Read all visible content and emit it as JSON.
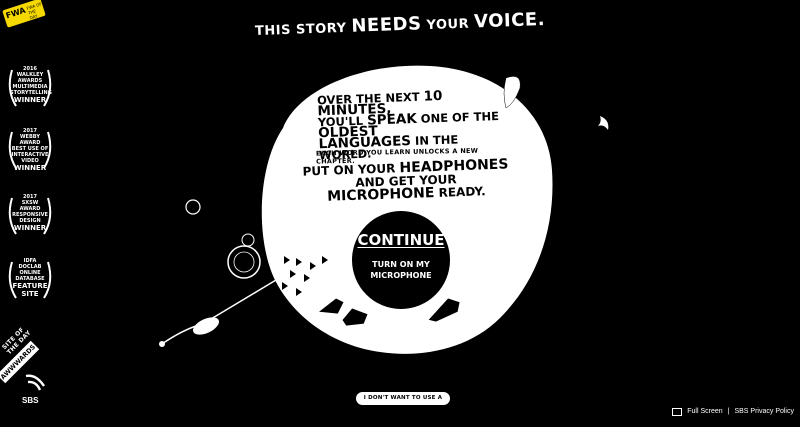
{
  "headline": {
    "part1": "THIS STORY",
    "part2": "NEEDS",
    "part3": "YOUR",
    "part4": "VOICE."
  },
  "intro": {
    "l1a": "OVER THE NEXT",
    "l1b": "10 MINUTES,",
    "l2a": "YOU'LL",
    "l2b": "SPEAK",
    "l2c": "ONE OF THE",
    "l2d": "OLDEST",
    "l3a": "LANGUAGES",
    "l3b": "IN THE WORLD.",
    "note": "EACH WORD YOU LEARN UNLOCKS A NEW CHAPTER."
  },
  "headphones": {
    "a": "PUT ON YOUR",
    "b": "HEADPHONES",
    "c": "AND GET YOUR",
    "d": "MICROPHONE",
    "e": "READY."
  },
  "continue": {
    "label": "CONTINUE",
    "sub": "TURN ON MY MICROPHONE"
  },
  "no_mic": "I DON'T WANT TO USE A MICROPHONE",
  "logo": {
    "name": "FWA",
    "small": "FWA OF THE DAY"
  },
  "awards": [
    {
      "line1": "2016",
      "line2": "WALKLEY",
      "line3": "AWARDS",
      "line4": "MULTIMEDIA STORYTELLING",
      "result": "WINNER"
    },
    {
      "line1": "2017",
      "line2": "WEBBY",
      "line3": "AWARD",
      "line4": "BEST USE OF INTERACTIVE VIDEO",
      "result": "WINNER"
    },
    {
      "line1": "2017",
      "line2": "SXSW",
      "line3": "AWARD",
      "line4": "RESPONSIVE DESIGN",
      "result": "WINNER"
    },
    {
      "line1": "IDFA",
      "line2": "DOCLAB",
      "line3": "ONLINE",
      "line4": "DATABASE",
      "result": "FEATURE SITE"
    }
  ],
  "site_of_day": "SITE OF THE DAY",
  "awwwards": "AWWWARDS",
  "sbs": "SBS",
  "footer": {
    "fullscreen": "Full Screen",
    "divider": "|",
    "privacy": "SBS Privacy Policy"
  }
}
